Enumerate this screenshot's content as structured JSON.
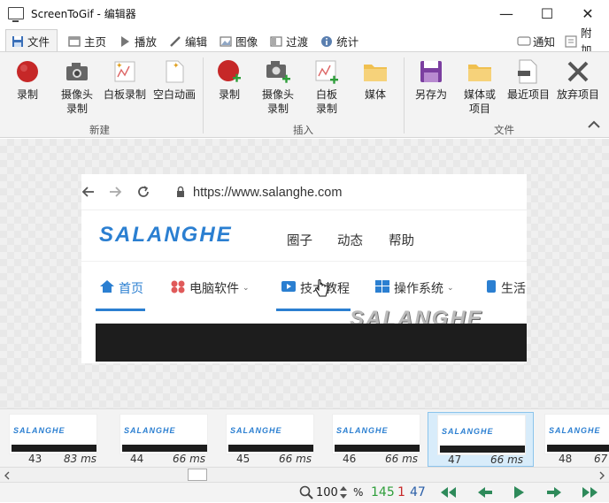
{
  "window": {
    "title": "ScreenToGif - 编辑器",
    "minimize": "—",
    "maximize": "☐",
    "close": "✕"
  },
  "tabs": [
    {
      "label": "文件",
      "icon": "save-icon"
    },
    {
      "label": "主页",
      "icon": "home-icon"
    },
    {
      "label": "播放",
      "icon": "play-icon"
    },
    {
      "label": "编辑",
      "icon": "pencil-icon"
    },
    {
      "label": "图像",
      "icon": "image-icon"
    },
    {
      "label": "过渡",
      "icon": "transition-icon"
    },
    {
      "label": "统计",
      "icon": "info-icon"
    }
  ],
  "tab_extras": {
    "notify": "通知",
    "attach": "附加"
  },
  "ribbon": {
    "new_group": {
      "label": "新建",
      "buttons": [
        "录制",
        "摄像头\n录制",
        "白板录制",
        "空白动画"
      ]
    },
    "insert_group": {
      "label": "插入",
      "buttons": [
        "录制",
        "摄像头\n录制",
        "白板\n录制",
        "媒体"
      ]
    },
    "file_group": {
      "label": "文件",
      "buttons": [
        "另存为",
        "媒体或\n项目",
        "最近项目",
        "放弃项目"
      ]
    }
  },
  "browser": {
    "url": "https://www.salanghe.com"
  },
  "site": {
    "logo": "SALANGHE",
    "nav": [
      "圈子",
      "动态",
      "帮助"
    ],
    "categories": [
      "首页",
      "电脑软件",
      "技术教程",
      "操作系统",
      "生活"
    ],
    "watermark": "SALANGHE"
  },
  "timeline": {
    "frames": [
      {
        "num": "43",
        "ms": "83 ms"
      },
      {
        "num": "44",
        "ms": "66 ms"
      },
      {
        "num": "45",
        "ms": "66 ms"
      },
      {
        "num": "46",
        "ms": "66 ms"
      },
      {
        "num": "47",
        "ms": "66 ms",
        "selected": true
      },
      {
        "num": "48",
        "ms": "67"
      }
    ],
    "thumb_logo": "SALANGHE"
  },
  "status": {
    "zoom": "100",
    "zoom_unit": "%",
    "total_frames": "145",
    "selected_count": "1",
    "current_frame": "47"
  },
  "colors": {
    "accent": "#2b7fd1",
    "green": "#2e9e3a",
    "red": "#c62828"
  }
}
